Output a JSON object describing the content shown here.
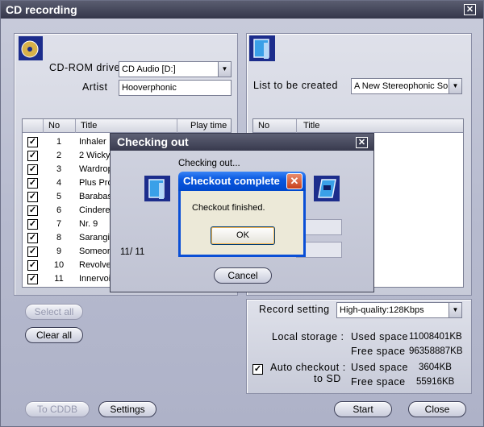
{
  "window": {
    "title": "CD recording"
  },
  "left": {
    "cdrom_label": "CD-ROM drive",
    "cdrom_value": "CD Audio [D:]",
    "artist_label": "Artist",
    "artist_value": "Hooverphonic",
    "columns": [
      "No",
      "Title",
      "Play time"
    ],
    "tracks": [
      {
        "no": "1",
        "title": "Inhaler"
      },
      {
        "no": "2",
        "title": "2 Wicky"
      },
      {
        "no": "3",
        "title": "Wardrop"
      },
      {
        "no": "4",
        "title": "Plus Pro"
      },
      {
        "no": "5",
        "title": "Barabas"
      },
      {
        "no": "6",
        "title": "Cinderel"
      },
      {
        "no": "7",
        "title": "Nr. 9"
      },
      {
        "no": "8",
        "title": "Sarangi"
      },
      {
        "no": "9",
        "title": "Someon"
      },
      {
        "no": "10",
        "title": "Revolve"
      },
      {
        "no": "11",
        "title": "Innervoi"
      }
    ],
    "select_all": "Select all",
    "clear_all": "Clear all"
  },
  "right": {
    "list_label": "List to be created",
    "list_value": "A New Stereophonic So",
    "columns": [
      "No",
      "Title"
    ],
    "record_label": "Record setting",
    "record_value": "High-quality:128Kbps",
    "local_storage_label": "Local storage :",
    "used_label": "Used space",
    "free_label": "Free space",
    "local_used": "11008401KB",
    "local_free": "96358887KB",
    "auto_label_1": "Auto checkout :",
    "auto_label_2": "to SD",
    "sd_used": "3604KB",
    "sd_free": "55916KB"
  },
  "bottom": {
    "to_cddb": "To CDDB",
    "settings": "Settings",
    "start": "Start",
    "close": "Close"
  },
  "checking": {
    "title": "Checking out",
    "status": "Checking out...",
    "progress": "11/ 11",
    "cancel": "Cancel"
  },
  "complete": {
    "title": "Checkout complete",
    "message": "Checkout finished.",
    "ok": "OK"
  },
  "colors": {
    "xp_blue": "#0a58e0",
    "title_dark": "#34364a"
  }
}
